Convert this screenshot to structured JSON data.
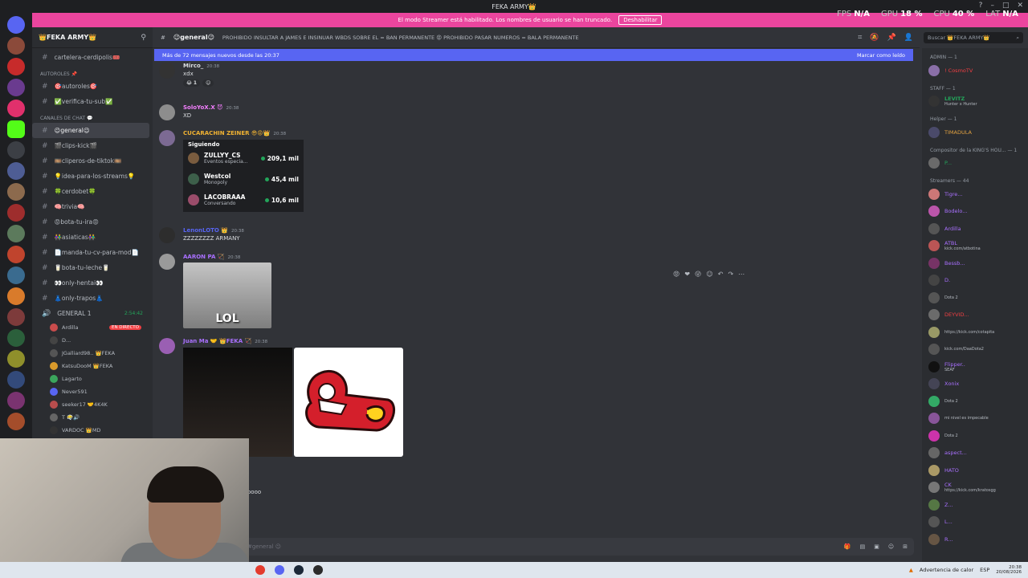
{
  "window": {
    "title": "FEKA ARMY👑"
  },
  "banner": {
    "text": "El modo Streamer está habilitado. Los nombres de usuario se han truncado.",
    "button": "Deshabilitar"
  },
  "perf": {
    "fps_label": "FPS",
    "fps": "N/A",
    "gpu_label": "GPU",
    "gpu": "18 %",
    "cpu_label": "CPU",
    "cpu": "40 %",
    "lat_label": "LAT",
    "lat": "N/A"
  },
  "server": {
    "name": "👑FEKA ARMY👑"
  },
  "channels": {
    "top": {
      "name": "cartelera-cerdipolis🎟️"
    },
    "cat1": "AUTOROLES 📌",
    "cat1_items": [
      {
        "name": "🎯autoroles🎯"
      },
      {
        "name": "✅verifica-tu-sub✅"
      }
    ],
    "cat2": "CANALES DE CHAT 💬",
    "cat2_items": [
      {
        "name": "😉general😉"
      },
      {
        "name": "🎬clips-kick🎬"
      },
      {
        "name": "🎞️cliperos-de-tiktok🎞️"
      },
      {
        "name": "💡idea-para-los-streams💡"
      },
      {
        "name": "🍀cerdobet🍀"
      },
      {
        "name": "🧠trivia🧠"
      },
      {
        "name": "😡bota-tu-ira😡"
      },
      {
        "name": "👫asiaticas👫"
      },
      {
        "name": "📄manda-tu-cv-para-mod📄"
      },
      {
        "name": "🥛bota-tu-leche🥛"
      },
      {
        "name": "👀only-hentai👀"
      },
      {
        "name": "👗only-trapos👗"
      }
    ],
    "voice_name": "GENERAL 1",
    "voice_timer": "2:54:42",
    "voice_users": [
      {
        "name": "Ardilla",
        "live": "EN DIRECTO"
      },
      {
        "name": "D..."
      },
      {
        "name": "JGalliard98.. 👑FEKA"
      },
      {
        "name": "KatsuDooM 👑FEKA"
      },
      {
        "name": "Lagarto"
      },
      {
        "name": "Never591"
      },
      {
        "name": "seeker17 🤝4K4K"
      },
      {
        "name": "T 😶‍🌫️🔊"
      },
      {
        "name": "VARDOC 👑MD"
      }
    ]
  },
  "header": {
    "channel": "😉general😉",
    "topic": "PROHIBIDO INSULTAR A JAMES E INSINUAR WBDS SOBRE EL = BAN PERMANENTE 😡 PROHIBIDO PASAR NUMEROS = BALA PERMANENTE",
    "search": "Buscar 👑FEKA ARMY👑"
  },
  "newbar": {
    "left": "Más de 72 mensajes nuevos desde las 20:37",
    "right": "Marcar como leído"
  },
  "messages": [
    {
      "author": "Mirco_",
      "time": "20:38",
      "text": "xdx",
      "reaction": "1"
    },
    {
      "author": "SoloYoX.X 😈",
      "time": "20:38",
      "text": "XD"
    },
    {
      "author": "CUCARACHIN ZEINER 😎😡👑",
      "time": "20:38",
      "embed_title": "Siguiendo",
      "embed": [
        {
          "name": "ZULLYY_CS",
          "sub": "Eventos especia...",
          "count": "209,1 mil"
        },
        {
          "name": "Westcol",
          "sub": "Monopoly",
          "count": "45,4 mil"
        },
        {
          "name": "LACOBRAAA",
          "sub": "Conversando",
          "count": "10,6 mil"
        }
      ]
    },
    {
      "author": "LenonLOTO 👑",
      "time": "20:38",
      "text": "ZZZZZZZZ ARMANY"
    },
    {
      "author": "AARON PA 🏹",
      "time": "20:38",
      "image_label": "LOL"
    },
    {
      "author": "Juan Ma 🤝 👑FEKA 🏹",
      "time": "20:38"
    }
  ],
  "partial": {
    "text": "oooo",
    "input": "#general 😉"
  },
  "members": {
    "groups": [
      {
        "label": "ADMIN — 1",
        "people": [
          {
            "name": "! CosmoTV"
          }
        ]
      },
      {
        "label": "STAFF — 1",
        "people": [
          {
            "name": "LEVITZ",
            "status": "Hunter x Hunter"
          }
        ]
      },
      {
        "label": "Helper — 1",
        "people": [
          {
            "name": "TIMADULA"
          }
        ]
      },
      {
        "label": "Compositor de la KING'S HOU... — 1",
        "people": [
          {
            "name": "P..."
          }
        ]
      },
      {
        "label": "Streamers — 44",
        "people": [
          {
            "name": "Tigre..."
          },
          {
            "name": "Bodelo..."
          },
          {
            "name": "Ardilla"
          },
          {
            "name": "ATBL",
            "status": "kick.com/atbotina"
          },
          {
            "name": "Bessb..."
          },
          {
            "name": "D."
          },
          {
            "name": "",
            "status": "Dota 2"
          },
          {
            "name": "DEYVID..."
          },
          {
            "name": "",
            "status": "https://kick.com/cotapita"
          },
          {
            "name": "",
            "status": "kick.com/DaaDota2"
          },
          {
            "name": "Flipper..",
            "status": "SEAF"
          },
          {
            "name": "Xonix"
          },
          {
            "name": "",
            "status": "Dota 2"
          },
          {
            "name": "",
            "status": "mi nivel es impecable"
          },
          {
            "name": "",
            "status": "Dota 2"
          },
          {
            "name": "aspect..."
          },
          {
            "name": "HATO"
          },
          {
            "name": "CK",
            "status": "https://kick.com/kratosgg"
          },
          {
            "name": "Z..."
          },
          {
            "name": "L..."
          },
          {
            "name": "R..."
          }
        ]
      }
    ]
  },
  "taskbar": {
    "weather": "Advertencia de calor",
    "lang": "ESP",
    "time": "20:38",
    "date": "20/08/2026"
  }
}
